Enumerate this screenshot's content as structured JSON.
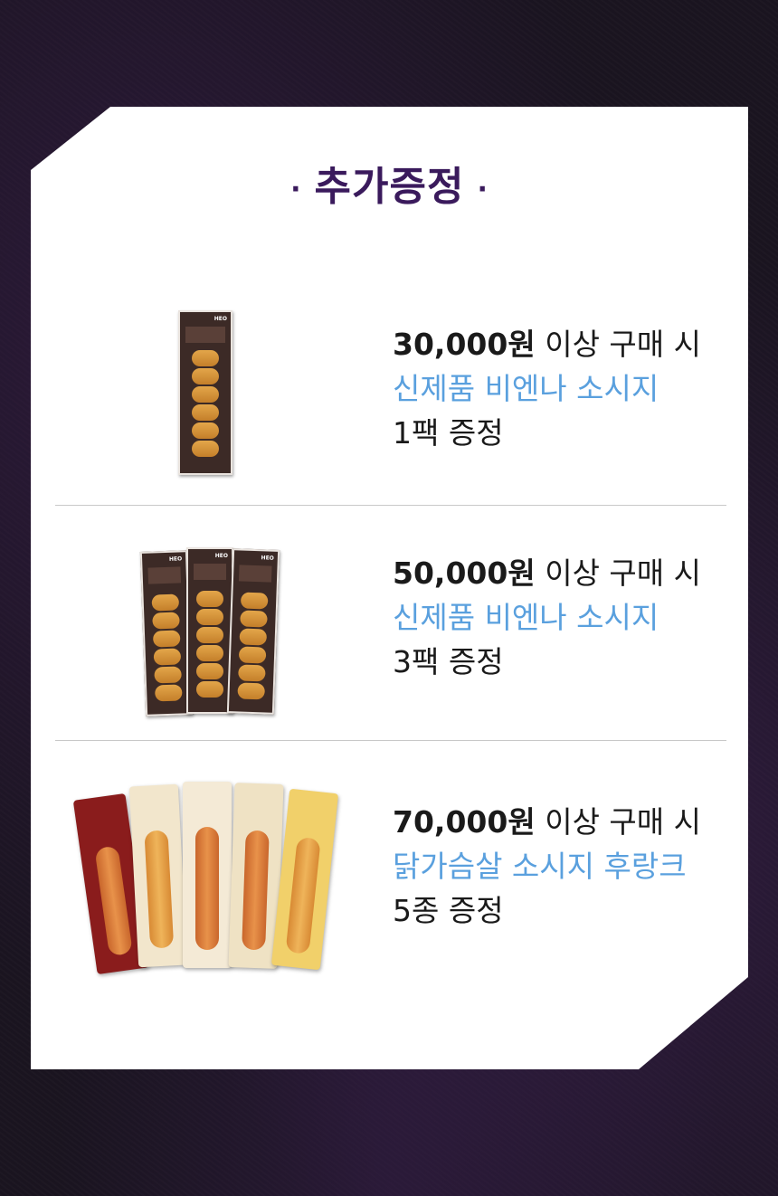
{
  "heading": {
    "dot_left": "·",
    "title": "추가증정",
    "dot_right": "·"
  },
  "gifts": [
    {
      "price": "30,000원",
      "condition": " 이상 구매 시",
      "product": "신제품 비엔나 소시지",
      "quantity": "1팩 증정"
    },
    {
      "price": "50,000원",
      "condition": " 이상 구매 시",
      "product": "신제품 비엔나 소시지",
      "quantity": "3팩 증정"
    },
    {
      "price": "70,000원",
      "condition": " 이상 구매 시",
      "product": "닭가슴살 소시지 후랑크",
      "quantity": "5종 증정"
    }
  ],
  "colors": {
    "heading": "#3a1a5c",
    "product": "#5aa0de",
    "text": "#1a1a1a",
    "card": "#ffffff"
  }
}
